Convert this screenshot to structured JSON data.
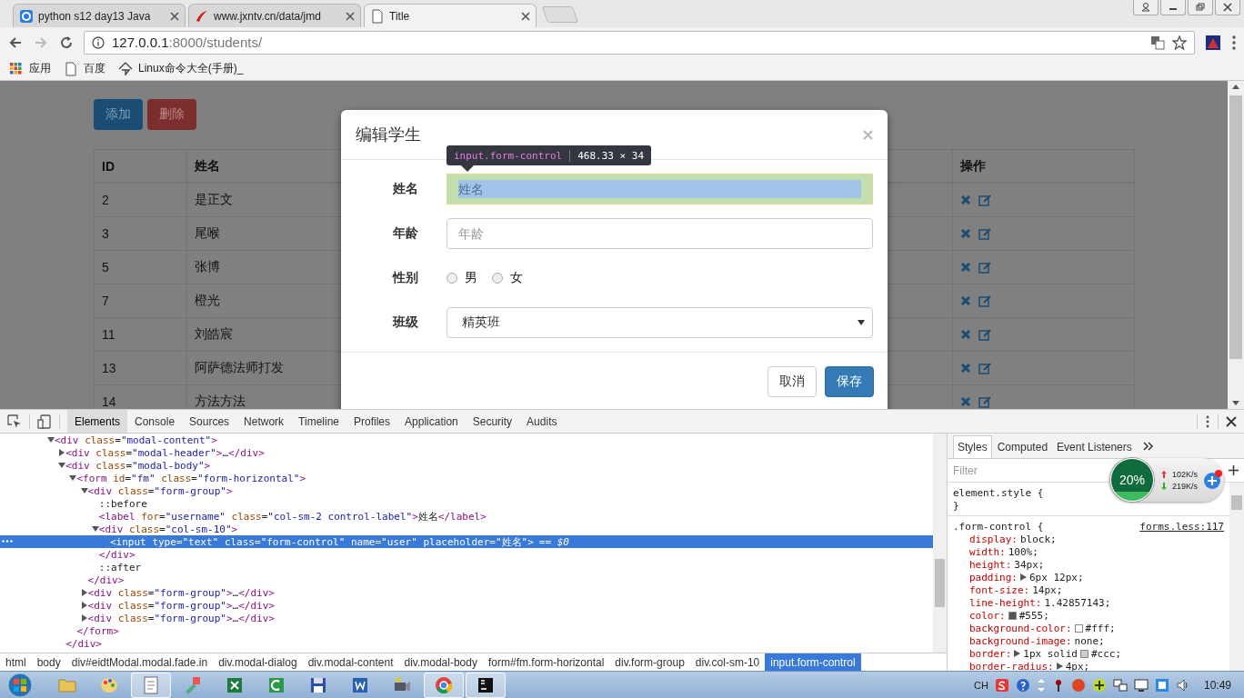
{
  "browser": {
    "tabs": [
      {
        "title": "python s12 day13 Java",
        "kind": "site",
        "selected": false
      },
      {
        "title": "www.jxntv.cn/data/jmd",
        "kind": "swoosh",
        "selected": false
      },
      {
        "title": "Title",
        "kind": "page",
        "selected": true
      }
    ],
    "nav": [
      {
        "kind": "back",
        "disabled": false
      },
      {
        "kind": "forward",
        "disabled": true
      },
      {
        "kind": "reload",
        "disabled": false
      }
    ],
    "address": {
      "host": "127.0.0.1",
      "path": ":8000/students/"
    },
    "bookmarks": [
      {
        "label": "应用",
        "kind": "apps"
      },
      {
        "label": "百度",
        "kind": "page"
      },
      {
        "label": "Linux命令大全(手册)_",
        "kind": "site"
      }
    ]
  },
  "page": {
    "buttons": [
      {
        "label": "添加",
        "kind": "primary"
      },
      {
        "label": "删除",
        "kind": "danger"
      }
    ],
    "table": {
      "columns": [
        "ID",
        "姓名",
        "操作"
      ],
      "rows": [
        {
          "id": "2",
          "name": "是正文"
        },
        {
          "id": "3",
          "name": "尾喉"
        },
        {
          "id": "5",
          "name": "张博"
        },
        {
          "id": "7",
          "name": "橙光"
        },
        {
          "id": "11",
          "name": "刘皓宸"
        },
        {
          "id": "13",
          "name": "阿萨德法师打发"
        },
        {
          "id": "14",
          "name": "方法方法"
        }
      ]
    }
  },
  "modal": {
    "title": "编辑学生",
    "tooltip": {
      "selector": "input.form-control",
      "size": "468.33 × 34"
    },
    "fields": [
      {
        "label": "姓名",
        "kind": "text",
        "placeholder": "姓名",
        "highlighted": true
      },
      {
        "label": "年龄",
        "kind": "text",
        "placeholder": "年龄",
        "highlighted": false
      },
      {
        "label": "性别",
        "kind": "radio",
        "options": [
          {
            "label": "男",
            "selected": false
          },
          {
            "label": "女",
            "selected": false
          }
        ]
      },
      {
        "label": "班级",
        "kind": "select",
        "value": "精英班"
      }
    ],
    "buttons": [
      {
        "label": "取消",
        "kind": "default"
      },
      {
        "label": "保存",
        "kind": "primary"
      }
    ]
  },
  "devtools": {
    "tabs": [
      {
        "label": "Elements",
        "selected": true
      },
      {
        "label": "Console",
        "selected": false
      },
      {
        "label": "Sources",
        "selected": false
      },
      {
        "label": "Network",
        "selected": false
      },
      {
        "label": "Timeline",
        "selected": false
      },
      {
        "label": "Profiles",
        "selected": false
      },
      {
        "label": "Application",
        "selected": false
      },
      {
        "label": "Security",
        "selected": false
      },
      {
        "label": "Audits",
        "selected": false
      }
    ],
    "dom": [
      {
        "text": "<div class=\"modal-content\">",
        "expanded": true,
        "selected": false,
        "children": [
          {
            "text": "<div class=\"modal-header\">…</div>",
            "expanded": false,
            "selected": false
          },
          {
            "text": "<div class=\"modal-body\">",
            "expanded": true,
            "selected": false,
            "close": "</div>",
            "children": [
              {
                "text": "<form id=\"fm\" class=\"form-horizontal\">",
                "expanded": true,
                "selected": false,
                "close": "</form>",
                "children": [
                  {
                    "text": "<div class=\"form-group\">",
                    "expanded": true,
                    "selected": false,
                    "close": "</div>",
                    "children": [
                      {
                        "text": "::before",
                        "selected": false
                      },
                      {
                        "text": "<label for=\"username\" class=\"col-sm-2 control-label\">姓名</label>",
                        "selected": false
                      },
                      {
                        "text": "<div class=\"col-sm-10\">",
                        "expanded": true,
                        "selected": false,
                        "close": "</div>",
                        "children": [
                          {
                            "text": "<input type=\"text\" class=\"form-control\" name=\"user\" placeholder=\"姓名\">",
                            "marker": "== $0",
                            "selected": true
                          }
                        ]
                      },
                      {
                        "text": "::after",
                        "selected": false
                      }
                    ]
                  },
                  {
                    "text": "<div class=\"form-group\">…</div>",
                    "expanded": false,
                    "selected": false
                  },
                  {
                    "text": "<div class=\"form-group\">…</div>",
                    "expanded": false,
                    "selected": false
                  },
                  {
                    "text": "<div class=\"form-group\">…</div>",
                    "expanded": false,
                    "selected": false
                  }
                ]
              }
            ]
          }
        ]
      }
    ],
    "breadcrumbs": [
      {
        "label": "html",
        "selected": false
      },
      {
        "label": "body",
        "selected": false
      },
      {
        "label": "div#eidtModal.modal.fade.in",
        "selected": false
      },
      {
        "label": "div.modal-dialog",
        "selected": false
      },
      {
        "label": "div.modal-content",
        "selected": false
      },
      {
        "label": "div.modal-body",
        "selected": false
      },
      {
        "label": "form#fm.form-horizontal",
        "selected": false
      },
      {
        "label": "div.form-group",
        "selected": false
      },
      {
        "label": "div.col-sm-10",
        "selected": false
      },
      {
        "label": "input.form-control",
        "selected": true
      }
    ],
    "styles": {
      "tabs": [
        {
          "label": "Styles",
          "selected": true
        },
        {
          "label": "Computed",
          "selected": false
        },
        {
          "label": "Event Listeners",
          "selected": false
        }
      ],
      "filter_placeholder": "Filter",
      "rules": [
        {
          "selector": "element.style {",
          "close": "}"
        },
        {
          "selector": ".form-control {",
          "source": "forms.less:117",
          "properties": [
            {
              "name": "display:",
              "value": "block;"
            },
            {
              "name": "width:",
              "value": "100%;"
            },
            {
              "name": "height:",
              "value": "34px;"
            },
            {
              "name": "padding:",
              "value": "6px 12px;",
              "expandable": true
            },
            {
              "name": "font-size:",
              "value": "14px;"
            },
            {
              "name": "line-height:",
              "value": "1.42857143;"
            },
            {
              "name": "color:",
              "value": "#555;",
              "color": "#555555"
            },
            {
              "name": "background-color:",
              "value": "#fff;",
              "color": "#ffffff"
            },
            {
              "name": "background-image:",
              "value": "none;"
            },
            {
              "name": "border:",
              "value": "1px solid",
              "expandable": true,
              "color": "#cccccc",
              "after": "#ccc;"
            },
            {
              "name": "border-radius:",
              "value": "4px;",
              "expandable": true
            }
          ]
        }
      ]
    }
  },
  "net_meter": {
    "reading": "20%",
    "up": "102K/s",
    "down": "219K/s"
  },
  "taskbar": {
    "apps": [
      {
        "kind": "folder",
        "active": false
      },
      {
        "kind": "palette",
        "active": false
      },
      {
        "kind": "notepad",
        "active": true
      },
      {
        "kind": "tool",
        "active": false
      },
      {
        "kind": "sheet",
        "active": false
      },
      {
        "kind": "green",
        "active": false
      },
      {
        "kind": "floppy",
        "active": false
      },
      {
        "kind": "doc",
        "active": false
      },
      {
        "kind": "camera",
        "active": false
      },
      {
        "kind": "chrome",
        "active": true
      },
      {
        "kind": "dark",
        "active": true
      }
    ],
    "language": "CH",
    "clock": "10:49"
  }
}
